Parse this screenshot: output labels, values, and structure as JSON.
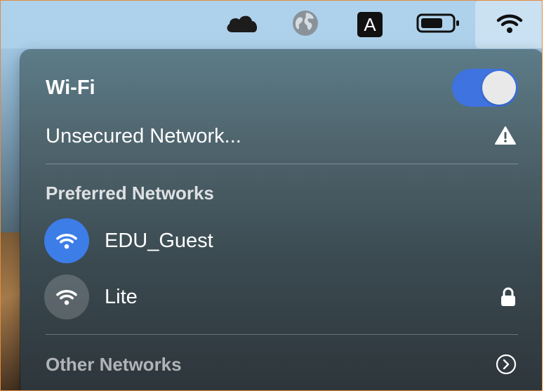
{
  "menubar": {
    "icons": [
      "cloud-icon",
      "globe-icon",
      "input-source-icon",
      "battery-icon",
      "wifi-icon"
    ],
    "input_source_label": "A"
  },
  "wifi_panel": {
    "title": "Wi-Fi",
    "toggle_on": true,
    "current_network": {
      "label": "Unsecured Network...",
      "icon": "warning-icon"
    },
    "preferred_section_label": "Preferred Networks",
    "preferred_networks": [
      {
        "name": "EDU_Guest",
        "connected": true,
        "secured": false
      },
      {
        "name": "Lite",
        "connected": false,
        "secured": true
      }
    ],
    "other_networks_label": "Other Networks",
    "colors": {
      "toggle_on": "#3e73e0",
      "connected_network": "#3d7de7"
    }
  }
}
